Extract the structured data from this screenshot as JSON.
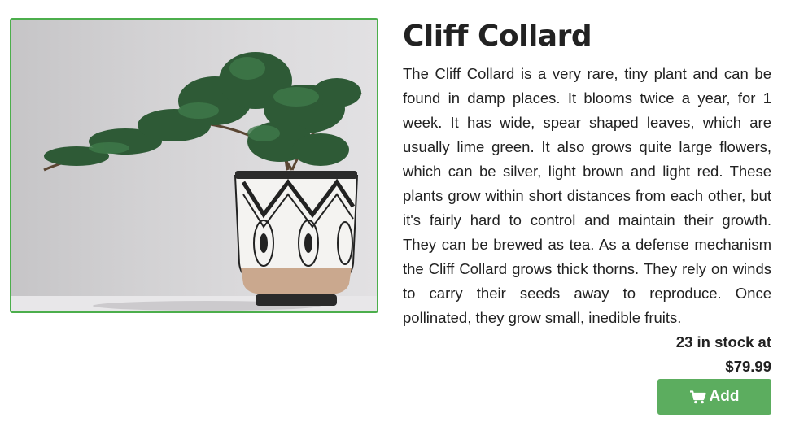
{
  "product": {
    "image_alt": "Plant in a patterned pot",
    "title": "Cliff Collard",
    "description": "The Cliff Collard is a very rare, tiny plant and can be found in damp places. It blooms twice a year, for 1 week. It has wide, spear shaped leaves, which are usually lime green. It also grows quite large flowers, which can be silver, light brown and light red. These plants grow within short distances from each other, but it's fairly hard to control and maintain their growth. They can be brewed as tea. As a defense mechanism the Cliff Collard grows thick thorns. They rely on winds to carry their seeds away to reproduce. Once pollinated, they grow small, inedible fruits.",
    "stock_text": "23 in stock at",
    "price": "$79.99"
  },
  "add_button": {
    "label": "Add",
    "icon": "shopping-cart-icon"
  },
  "colors": {
    "accent_green": "#5cad5f",
    "image_border": "#4cae4c",
    "text": "#222222"
  }
}
